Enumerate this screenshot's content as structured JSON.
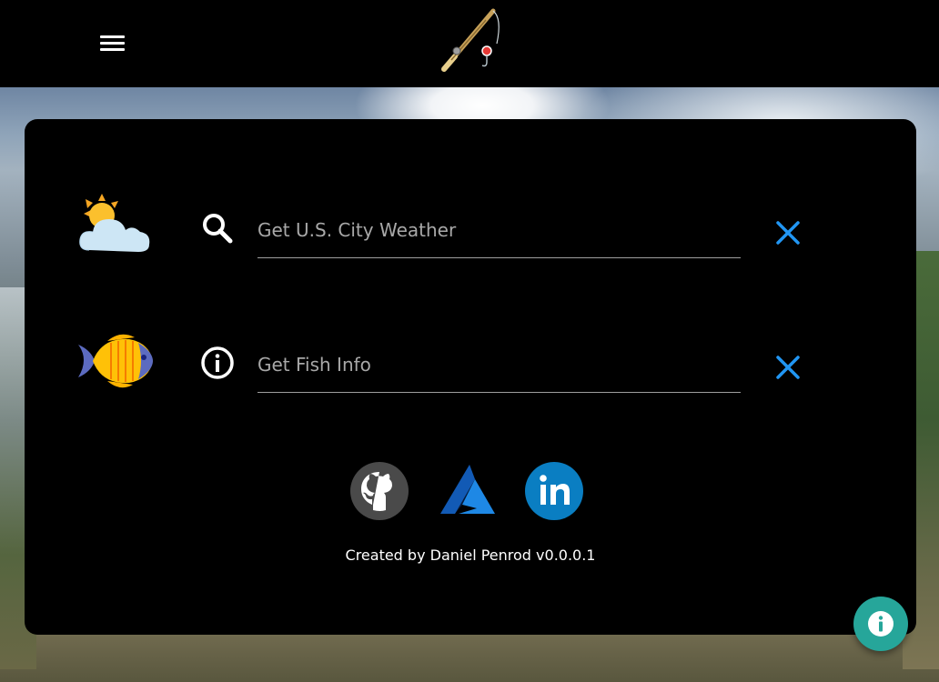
{
  "navbar": {
    "menu_icon": "hamburger-menu-icon",
    "logo_icon": "fishing-pole-icon"
  },
  "search": {
    "weather": {
      "placeholder": "Get U.S. City Weather",
      "value": "",
      "emoji_icon": "sun-behind-cloud-icon",
      "lead_icon": "search-icon",
      "clear_icon": "close-icon"
    },
    "fish": {
      "placeholder": "Get Fish Info",
      "value": "",
      "emoji_icon": "tropical-fish-icon",
      "lead_icon": "info-circle-icon",
      "clear_icon": "close-icon"
    }
  },
  "social": [
    {
      "name": "GitHub",
      "icon": "github-icon"
    },
    {
      "name": "Azure",
      "icon": "azure-icon"
    },
    {
      "name": "LinkedIn",
      "icon": "linkedin-icon"
    }
  ],
  "footer": {
    "credits": "Created by Daniel Penrod v0.0.0.1"
  },
  "fab": {
    "icon": "info-icon"
  },
  "colors": {
    "accent_blue": "#2196f3",
    "fab_teal": "#26a69a",
    "card_bg": "#000000",
    "placeholder_gray": "#a8a8a8"
  }
}
